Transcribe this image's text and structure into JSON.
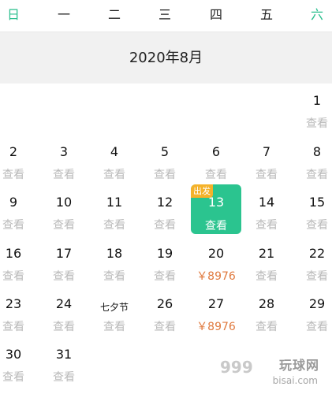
{
  "weekdays": [
    "日",
    "一",
    "二",
    "三",
    "四",
    "五",
    "六"
  ],
  "month_title": "2020年8月",
  "view_label": "查看",
  "depart_badge": "出发",
  "days": {
    "d1": {
      "num": "1",
      "sub": "查看"
    },
    "d2": {
      "num": "2",
      "sub": "查看"
    },
    "d3": {
      "num": "3",
      "sub": "查看"
    },
    "d4": {
      "num": "4",
      "sub": "查看"
    },
    "d5": {
      "num": "5",
      "sub": "查看"
    },
    "d6": {
      "num": "6",
      "sub": "查看"
    },
    "d7": {
      "num": "7",
      "sub": "查看"
    },
    "d8": {
      "num": "8",
      "sub": "查看"
    },
    "d9": {
      "num": "9",
      "sub": "查看"
    },
    "d10": {
      "num": "10",
      "sub": "查看"
    },
    "d11": {
      "num": "11",
      "sub": "查看"
    },
    "d12": {
      "num": "12",
      "sub": "查看"
    },
    "d13": {
      "num": "13",
      "sub": "查看"
    },
    "d14": {
      "num": "14",
      "sub": "查看"
    },
    "d15": {
      "num": "15",
      "sub": "查看"
    },
    "d16": {
      "num": "16",
      "sub": "查看"
    },
    "d17": {
      "num": "17",
      "sub": "查看"
    },
    "d18": {
      "num": "18",
      "sub": "查看"
    },
    "d19": {
      "num": "19",
      "sub": "查看"
    },
    "d20": {
      "num": "20",
      "sub": "￥8976"
    },
    "d21": {
      "num": "21",
      "sub": "查看"
    },
    "d22": {
      "num": "22",
      "sub": "查看"
    },
    "d23": {
      "num": "23",
      "sub": "查看"
    },
    "d24": {
      "num": "24",
      "sub": "查看"
    },
    "d25": {
      "num": "七夕节",
      "sub": "查看"
    },
    "d26": {
      "num": "26",
      "sub": "查看"
    },
    "d27": {
      "num": "27",
      "sub": "￥8976"
    },
    "d28": {
      "num": "28",
      "sub": "查看"
    },
    "d29": {
      "num": "29",
      "sub": "查看"
    },
    "d30": {
      "num": "30",
      "sub": "查看"
    },
    "d31": {
      "num": "31",
      "sub": "查看"
    }
  },
  "watermark": {
    "logo": "999",
    "text": "玩球网",
    "domain": "bisai.com"
  },
  "colors": {
    "accent": "#2bc48f",
    "badge": "#f5b22a",
    "price": "#e07a3f",
    "muted": "#b9b9b9"
  }
}
